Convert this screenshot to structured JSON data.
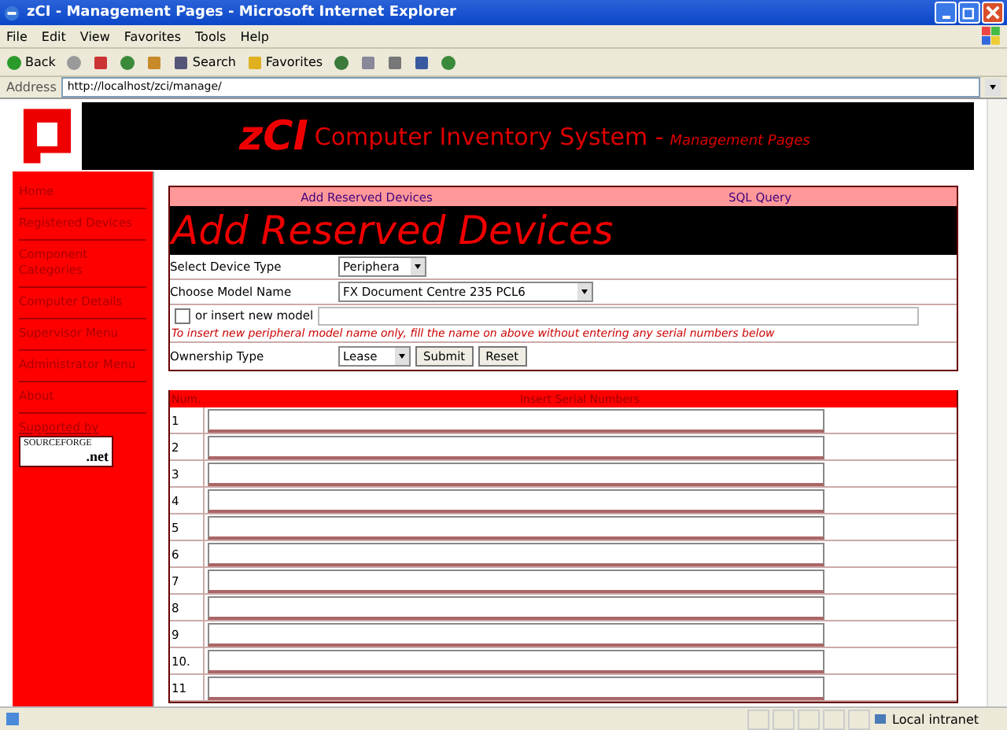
{
  "window": {
    "title": "zCI - Management Pages - Microsoft Internet Explorer"
  },
  "menu": [
    "File",
    "Edit",
    "View",
    "Favorites",
    "Tools",
    "Help"
  ],
  "toolbar": [
    {
      "kind": "back",
      "label": "Back"
    },
    {
      "kind": "forward"
    },
    {
      "kind": "stop"
    },
    {
      "kind": "refresh"
    },
    {
      "kind": "home"
    },
    {
      "kind": "search",
      "label": "Search"
    },
    {
      "kind": "favorites",
      "label": "Favorites"
    },
    {
      "kind": "media"
    },
    {
      "kind": "mail"
    },
    {
      "kind": "print"
    },
    {
      "kind": "edit"
    },
    {
      "kind": "messenger"
    }
  ],
  "address": {
    "label": "Address",
    "value": "http://localhost/zci/manage/"
  },
  "header": {
    "title": "zCI",
    "subtitle": "Computer Inventory System -",
    "tagline": "Management Pages"
  },
  "sidebar": {
    "items": [
      "Home",
      "Registered Devices",
      "Component Categories",
      "Computer Details",
      "Supervisor Menu",
      "Administrator Menu",
      "About"
    ],
    "supported_by": "Supported by",
    "logo_top": "SOURCEFORGE",
    "logo_bottom": ".net"
  },
  "tabs": [
    "Add Reserved Devices",
    "SQL Query"
  ],
  "heading": "Add Reserved Devices",
  "form": {
    "device_type": {
      "label": "Select Device Type",
      "value": "Periphera"
    },
    "model": {
      "label": "Choose Model Name",
      "value": "FX Document Centre 235 PCL6"
    },
    "new_model": {
      "label": "or insert new model",
      "checked": false
    },
    "note": "To insert new peripheral model name only, fill the name on above without entering any serial numbers below",
    "ownership": {
      "label": "Ownership Type",
      "value": "Lease"
    },
    "buttons": [
      "Submit",
      "Reset"
    ]
  },
  "serials": {
    "columns": [
      "Num.",
      "Insert Serial Numbers"
    ],
    "rows": [
      "1",
      "2",
      "3",
      "4",
      "5",
      "6",
      "7",
      "8",
      "9",
      "10.",
      "11"
    ]
  },
  "status_bar": {
    "zone": "Local intranet"
  }
}
